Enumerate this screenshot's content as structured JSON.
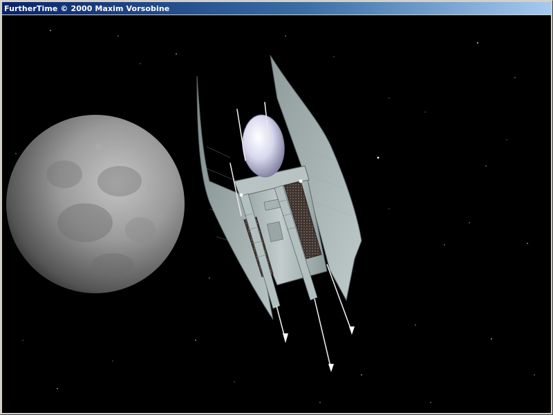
{
  "window": {
    "title": "FurtherTime © 2000 Maxim Vorsobine"
  },
  "scene": {
    "description_icons": [
      "moon-icon",
      "spaceship-icon",
      "starfield"
    ],
    "colors": {
      "space": "#000000",
      "moon": "#8a8a8a",
      "hull": "#aab5b5",
      "canopy": "#dcdcf0",
      "title_gradient_start": "#0a246a",
      "title_gradient_end": "#a6caf0"
    }
  }
}
